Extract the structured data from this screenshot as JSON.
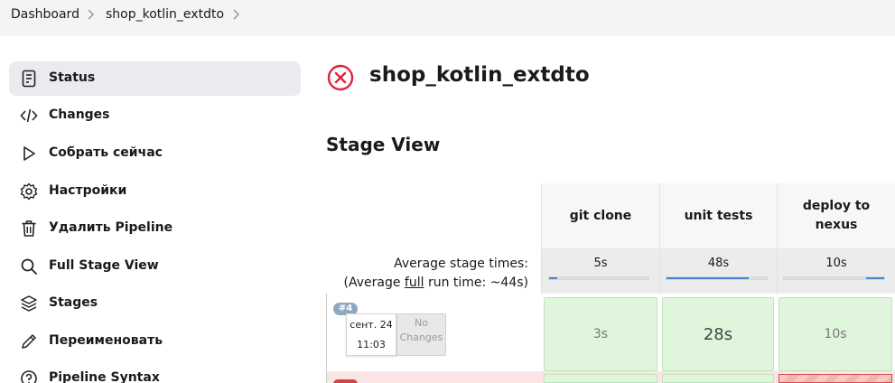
{
  "breadcrumb": {
    "items": [
      "Dashboard",
      "shop_kotlin_extdto"
    ]
  },
  "sidebar": {
    "items": [
      {
        "label": "Status",
        "icon": "status-document-icon",
        "active": true
      },
      {
        "label": "Changes",
        "icon": "code-brackets-icon"
      },
      {
        "label": "Собрать сейчас",
        "icon": "play-icon"
      },
      {
        "label": "Настройки",
        "icon": "gear-icon"
      },
      {
        "label": "Удалить Pipeline",
        "icon": "trash-icon"
      },
      {
        "label": "Full Stage View",
        "icon": "search-icon"
      },
      {
        "label": "Stages",
        "icon": "layers-icon"
      },
      {
        "label": "Переименовать",
        "icon": "pencil-icon"
      },
      {
        "label": "Pipeline Syntax",
        "icon": "help-circle-icon"
      }
    ]
  },
  "main": {
    "title": "shop_kotlin_extdto",
    "status_icon": "failed-status-icon",
    "status_color": "#e0243a"
  },
  "stage_view": {
    "title": "Stage View",
    "avg_label": "Average stage times:",
    "avg_full_prefix": "(Average ",
    "avg_full_word": "full",
    "avg_full_suffix": " run time: ~44s)",
    "stages": [
      {
        "name": "git clone",
        "avg": "5s",
        "avg_fraction": 0.08
      },
      {
        "name": "unit tests",
        "avg": "48s",
        "avg_fraction": 0.82
      },
      {
        "name": "deploy to nexus",
        "avg": "10s",
        "avg_fraction": 0.18
      }
    ],
    "runs": [
      {
        "badge": "#4",
        "date": "сент. 24",
        "time": "11:03",
        "changes": "No Changes",
        "durations": [
          "3s",
          "28s",
          "10s"
        ],
        "status": "success"
      },
      {
        "badge": "",
        "status": "failed",
        "cell_status": [
          "success",
          "success",
          "failed"
        ]
      }
    ],
    "colors": {
      "success_cell": "#dff5dc",
      "failed_cell": "#f8c9c9",
      "failed_row": "#fbe4e4",
      "bar": "#4a85d0"
    }
  }
}
